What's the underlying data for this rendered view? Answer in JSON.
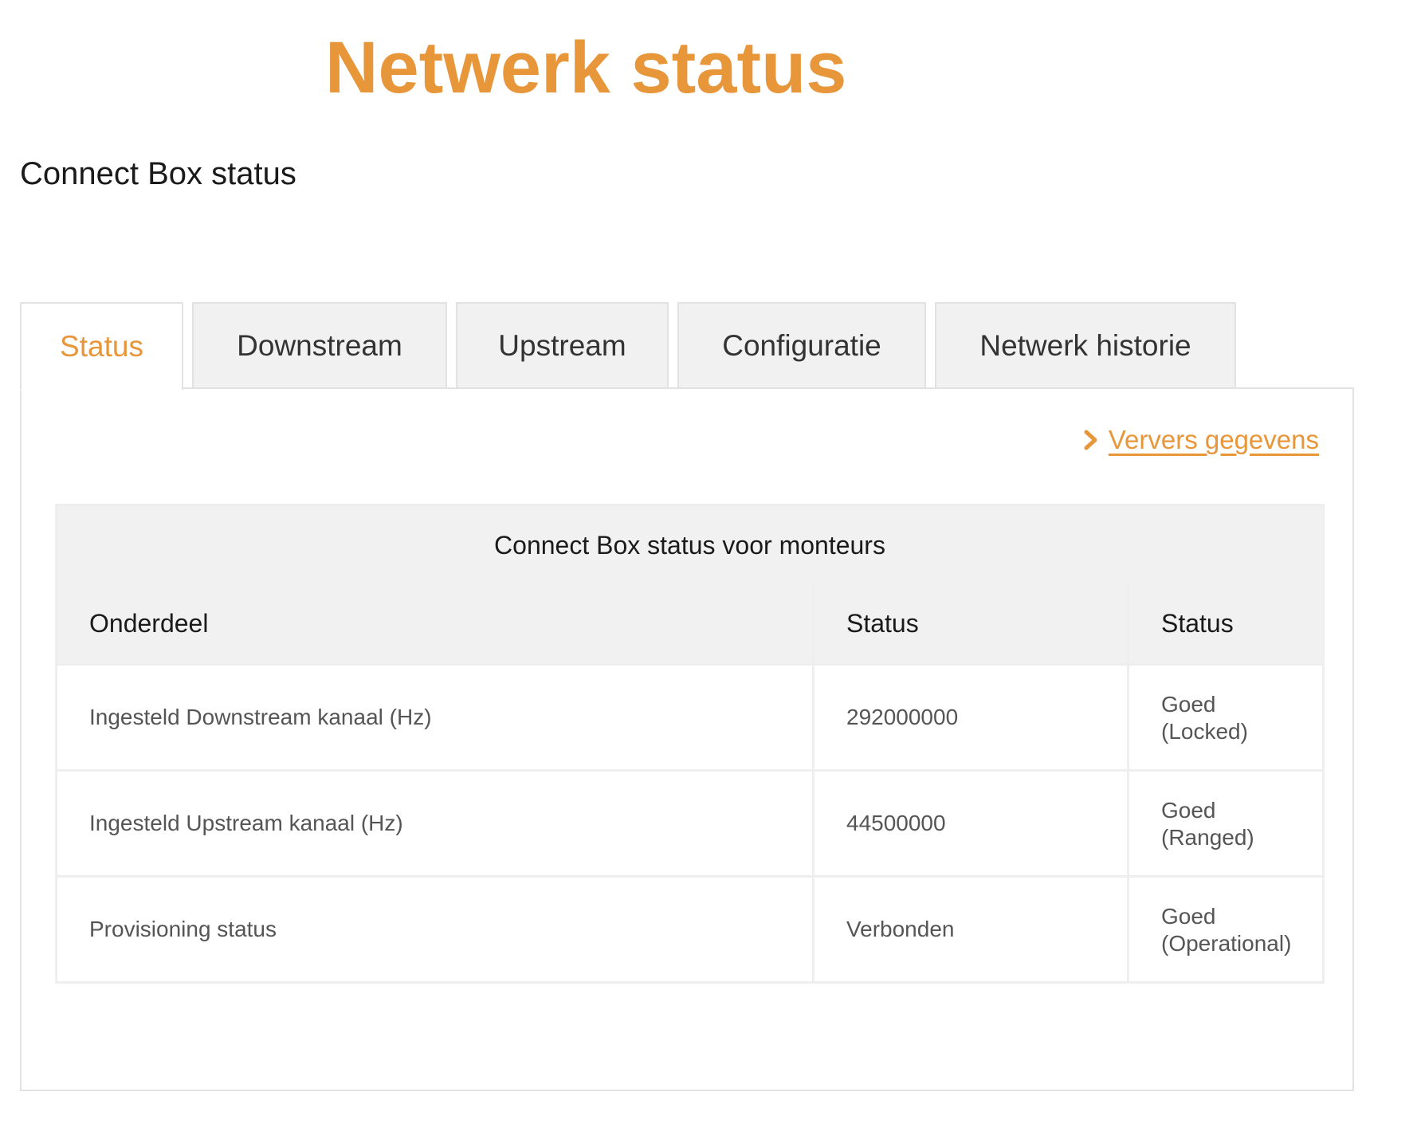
{
  "page_title": "Netwerk status",
  "section_title": "Connect Box status",
  "tabs": [
    {
      "label": "Status",
      "active": true
    },
    {
      "label": "Downstream",
      "active": false
    },
    {
      "label": "Upstream",
      "active": false
    },
    {
      "label": "Configuratie",
      "active": false
    },
    {
      "label": "Netwerk historie",
      "active": false
    }
  ],
  "refresh": {
    "label": "Ververs gegevens",
    "icon": "chevron-right-icon"
  },
  "table": {
    "caption": "Connect Box status voor monteurs",
    "headers": [
      "Onderdeel",
      "Status",
      "Status"
    ],
    "rows": [
      {
        "onderdeel": "Ingesteld Downstream kanaal (Hz)",
        "value": "292000000",
        "status_line1": "Goed",
        "status_line2": "(Locked)"
      },
      {
        "onderdeel": "Ingesteld Upstream kanaal (Hz)",
        "value": "44500000",
        "status_line1": "Goed",
        "status_line2": "(Ranged)"
      },
      {
        "onderdeel": "Provisioning status",
        "value": "Verbonden",
        "status_line1": "Goed",
        "status_line2": "(Operational)"
      }
    ]
  },
  "colors": {
    "accent": "#e8963a",
    "tab_bg": "#f1f1f1",
    "border": "#e2e2e2"
  }
}
